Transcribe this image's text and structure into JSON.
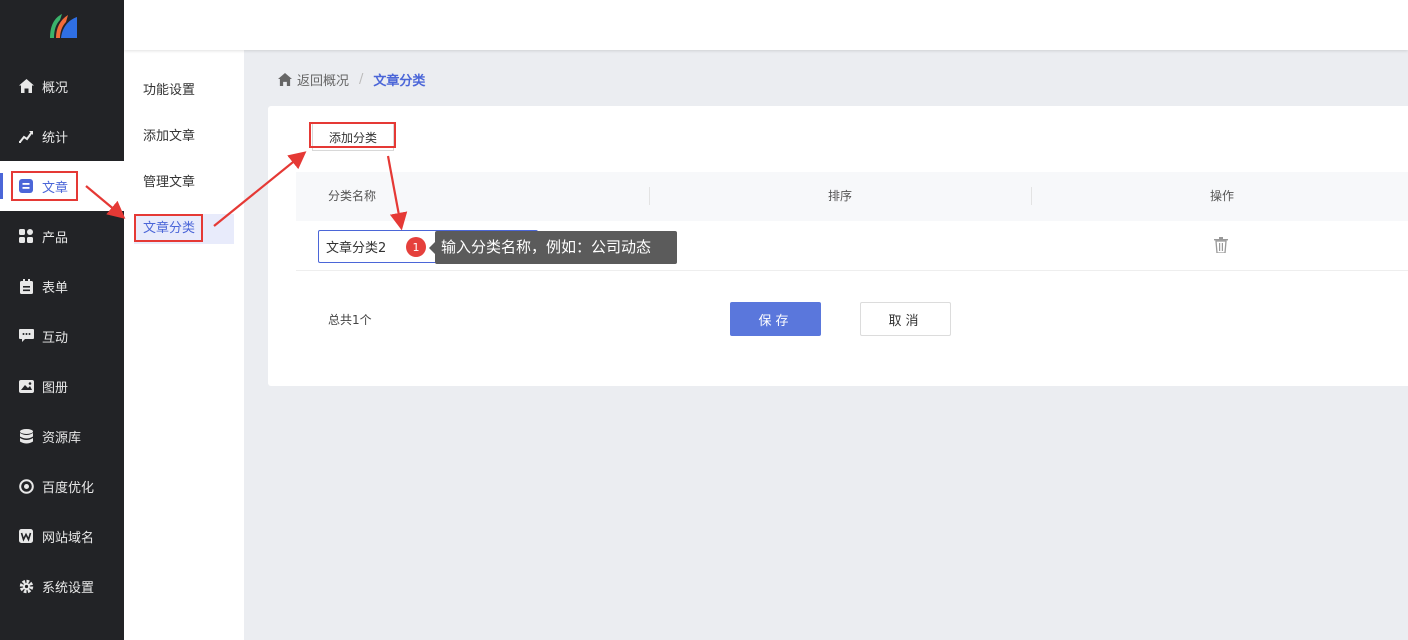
{
  "sidebar": {
    "items": [
      {
        "label": "概况",
        "icon": "home-icon"
      },
      {
        "label": "统计",
        "icon": "chart-line-icon"
      },
      {
        "label": "文章",
        "icon": "article-icon",
        "active": true
      },
      {
        "label": "产品",
        "icon": "grid-icon"
      },
      {
        "label": "表单",
        "icon": "clipboard-icon"
      },
      {
        "label": "互动",
        "icon": "chat-icon"
      },
      {
        "label": "图册",
        "icon": "album-icon"
      },
      {
        "label": "资源库",
        "icon": "database-icon"
      },
      {
        "label": "百度优化",
        "icon": "target-icon"
      },
      {
        "label": "网站域名",
        "icon": "w-icon"
      },
      {
        "label": "系统设置",
        "icon": "gear-icon"
      }
    ]
  },
  "submenu": {
    "items": [
      {
        "label": "功能设置"
      },
      {
        "label": "添加文章"
      },
      {
        "label": "管理文章"
      },
      {
        "label": "文章分类",
        "active": true
      }
    ]
  },
  "breadcrumb": {
    "back": "返回概况",
    "separator": "/",
    "current": "文章分类"
  },
  "toolbar": {
    "add_label": "添加分类"
  },
  "table": {
    "columns": [
      "分类名称",
      "排序",
      "操作"
    ],
    "rows": [
      {
        "name": "文章分类2"
      }
    ]
  },
  "footer": {
    "total": "总共1个",
    "save_label": "保存",
    "cancel_label": "取消"
  },
  "tooltip": {
    "badge": "1",
    "text": "输入分类名称，例如：公司动态"
  },
  "colors": {
    "accent": "#4b66d8",
    "sidebar_bg": "#222326",
    "annotation": "#e53935"
  }
}
